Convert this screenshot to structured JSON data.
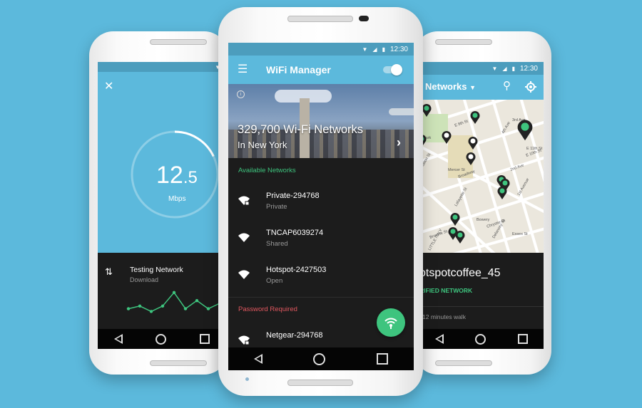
{
  "colors": {
    "background": "#5cb9dc",
    "toolbar": "#5cb9dc",
    "accent_green": "#3ec47e",
    "warning_red": "#e0575f",
    "dark": "#1c1c1c"
  },
  "left_phone": {
    "status_time": "",
    "close_icon": "close-icon",
    "speed_value": "12",
    "speed_decimal": ".5",
    "speed_unit": "Mbps",
    "speed_progress_percent": 18,
    "testing_title": "Testing Network",
    "testing_subtitle": "Download",
    "chart_values": [
      3,
      4,
      2,
      4,
      9,
      3,
      6,
      3,
      5
    ]
  },
  "center_phone": {
    "status_time": "12:30",
    "title": "WiFi Manager",
    "wifi_toggle_on": true,
    "hero_count": "329,700 Wi-Fi Networks",
    "hero_location": "In New York",
    "available_header": "Available Networks",
    "available": [
      {
        "name": "Private-294768",
        "type": "Private",
        "locked": true
      },
      {
        "name": "TNCAP6039274",
        "type": "Shared",
        "locked": false
      },
      {
        "name": "Hotspot-2427503",
        "type": "Open",
        "locked": false
      }
    ],
    "password_header": "Password Required",
    "password_networks": [
      {
        "name": "Netgear-294768",
        "locked": true
      }
    ]
  },
  "right_phone": {
    "status_time": "12:30",
    "title": "Networks",
    "network_name": "otspotcoffee_45",
    "network_badge": "RIFIED NETWORK",
    "distance": "12 minutes walk",
    "map_labels": [
      "E 8th St",
      "4th Ave",
      "3rd Ave",
      "2nd Ave",
      "1st Avenue",
      "E 11th St",
      "E 10th St",
      "Houston St",
      "Mercer St",
      "Broadway",
      "Lafayette St",
      "Bowery",
      "Chrystie St",
      "Delancey St",
      "Essex St",
      "Broome St",
      "LITTLE ITALY",
      "Park"
    ]
  }
}
